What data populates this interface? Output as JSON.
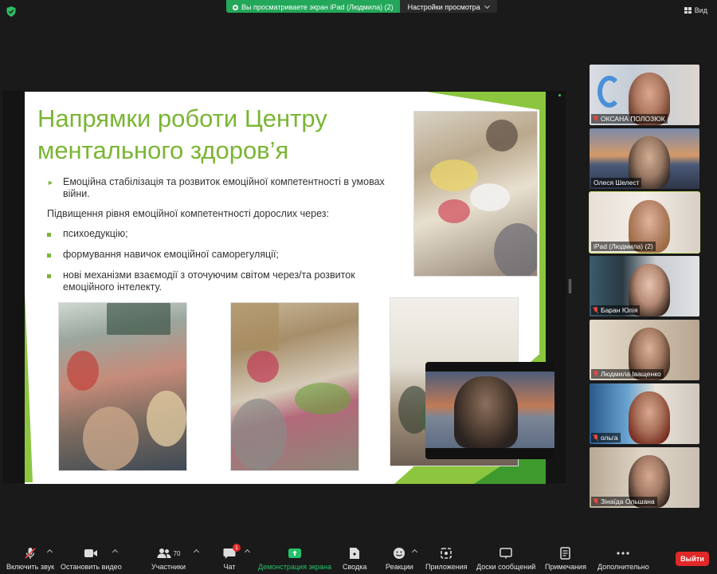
{
  "topbar": {
    "sharing_text": "Вы просматриваете экран iPad (Людмила) (2)",
    "view_settings": "Настройки просмотра",
    "view_label": "Вид"
  },
  "slide": {
    "title": "Напрямки роботи Центру ментального здоров’я",
    "bullet_main": "Емоційна стабілізація та розвиток емоційної компетентності в умовах війни.",
    "subheading": "Підвищення рівня емоційної компетентності дорослих через:",
    "sub_bullets": [
      "психоедукцію;",
      "формування навичок емоційної саморегуляції;",
      "нові механізми взаємодії з оточуючим світом через/та розвиток емоційного інтелекту."
    ]
  },
  "participants": [
    {
      "name": "ОКСАНА ПОЛОЗЮК",
      "muted": true
    },
    {
      "name": "Олеся Шелест",
      "muted": false
    },
    {
      "name": "iPad (Людмила) (2)",
      "muted": false,
      "active": true
    },
    {
      "name": "Баран Юлія",
      "muted": true
    },
    {
      "name": "Людмила Іващенко",
      "muted": true
    },
    {
      "name": "ольга",
      "muted": true
    },
    {
      "name": "Зінаїда Ольшана",
      "muted": true
    }
  ],
  "toolbar": {
    "unmute": "Включить звук",
    "stop_video": "Остановить видео",
    "participants": "Участники",
    "participants_count": "70",
    "chat": "Чат",
    "chat_badge": "1",
    "share_screen": "Демонстрация экрана",
    "summary": "Сводка",
    "reactions": "Реакции",
    "apps": "Приложения",
    "whiteboards": "Доски сообщений",
    "notes": "Примечания",
    "more": "Дополнительно",
    "leave": "Выйти"
  },
  "colors": {
    "accent_green": "#23a75a",
    "slide_green": "#7ab534",
    "leave_red": "#e02828",
    "active_border": "#cfe87a"
  }
}
